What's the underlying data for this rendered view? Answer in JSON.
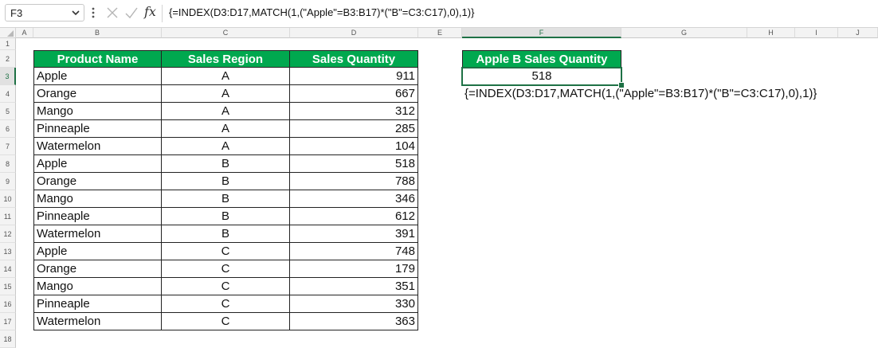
{
  "formula_bar": {
    "name_box": "F3",
    "fx_label": "fx",
    "formula": "{=INDEX(D3:D17,MATCH(1,(\"Apple\"=B3:B17)*(\"B\"=C3:C17),0),1)}"
  },
  "columns": [
    "A",
    "B",
    "C",
    "D",
    "E",
    "F",
    "G",
    "H",
    "I",
    "J"
  ],
  "selected_column": "F",
  "rows": [
    "1",
    "2",
    "3",
    "4",
    "5",
    "6",
    "7",
    "8",
    "9",
    "10",
    "11",
    "12",
    "13",
    "14",
    "15",
    "16",
    "17",
    "18"
  ],
  "selected_row": "3",
  "table": {
    "headers": [
      "Product Name",
      "Sales Region",
      "Sales Quantity"
    ],
    "rows": [
      [
        "Apple",
        "A",
        "911"
      ],
      [
        "Orange",
        "A",
        "667"
      ],
      [
        "Mango",
        "A",
        "312"
      ],
      [
        "Pinneaple",
        "A",
        "285"
      ],
      [
        "Watermelon",
        "A",
        "104"
      ],
      [
        "Apple",
        "B",
        "518"
      ],
      [
        "Orange",
        "B",
        "788"
      ],
      [
        "Mango",
        "B",
        "346"
      ],
      [
        "Pinneaple",
        "B",
        "612"
      ],
      [
        "Watermelon",
        "B",
        "391"
      ],
      [
        "Apple",
        "C",
        "748"
      ],
      [
        "Orange",
        "C",
        "179"
      ],
      [
        "Mango",
        "C",
        "351"
      ],
      [
        "Pinneaple",
        "C",
        "330"
      ],
      [
        "Watermelon",
        "C",
        "363"
      ]
    ]
  },
  "result": {
    "header": "Apple B Sales Quantity",
    "value": "518",
    "formula_note": "{=INDEX(D3:D17,MATCH(1,(\"Apple\"=B3:B17)*(\"B\"=C3:C17),0),1)}"
  },
  "colors": {
    "header_fill": "#00a84f",
    "selection": "#1e7145"
  },
  "icons": [
    "chevron-down-icon",
    "more-options-icon",
    "cancel-icon",
    "enter-check-icon",
    "insert-function-icon"
  ]
}
